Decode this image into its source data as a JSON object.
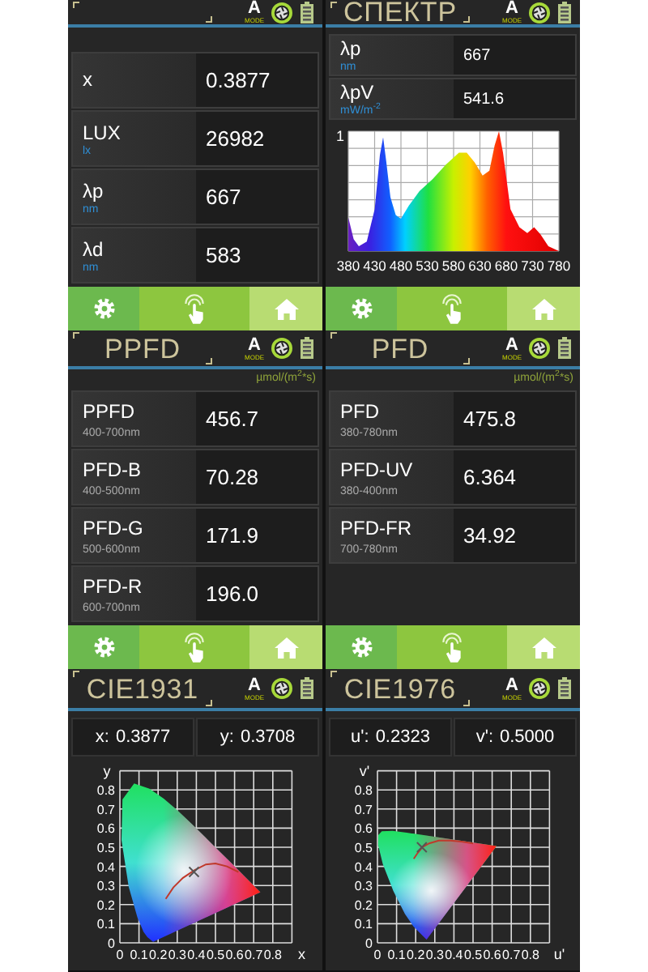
{
  "panels": [
    {
      "kind": "readings",
      "header": {
        "mode_letter": "A",
        "mode_caption": "MODE"
      },
      "rows": [
        {
          "label": "x",
          "value": "0.3877"
        },
        {
          "label": "LUX",
          "unit": "lx",
          "value": "26982"
        },
        {
          "label": "λp",
          "unit": "nm",
          "value": "667"
        },
        {
          "label": "λd",
          "unit": "nm",
          "value": "583"
        }
      ],
      "nav": true
    },
    {
      "kind": "spectrum",
      "header": {
        "title": "СПЕКТР",
        "mode_letter": "A",
        "mode_caption": "MODE"
      },
      "rows": [
        {
          "label": "λp",
          "unit": "nm",
          "value": "667"
        },
        {
          "label": "λpV",
          "unit": "mW/m$^{-2}$",
          "value": "541.6"
        }
      ],
      "spectrum": {
        "y_label": "1",
        "x_labels": [
          "380",
          "430",
          "480",
          "530",
          "580",
          "630",
          "680",
          "730",
          "780"
        ]
      },
      "nav": true
    },
    {
      "kind": "photon",
      "header": {
        "title": "PPFD",
        "mode_letter": "A",
        "mode_caption": "MODE"
      },
      "unit_note": "µmol/(m$^{2}$*s)",
      "rows": [
        {
          "label": "PPFD",
          "range": "400-700nm",
          "value": "456.7"
        },
        {
          "label": "PFD-B",
          "range": "400-500nm",
          "value": "70.28"
        },
        {
          "label": "PFD-G",
          "range": "500-600nm",
          "value": "171.9"
        },
        {
          "label": "PFD-R",
          "range": "600-700nm",
          "value": "196.0"
        }
      ],
      "nav": true
    },
    {
      "kind": "photon",
      "header": {
        "title": "PFD",
        "mode_letter": "A",
        "mode_caption": "MODE"
      },
      "unit_note": "µmol/(m$^{2}$*s)",
      "rows": [
        {
          "label": "PFD",
          "range": "380-780nm",
          "value": "475.8"
        },
        {
          "label": "PFD-UV",
          "range": "380-400nm",
          "value": "6.364"
        },
        {
          "label": "PFD-FR",
          "range": "700-780nm",
          "value": "34.92"
        }
      ],
      "nav": true
    },
    {
      "kind": "chromaticity",
      "header": {
        "title": "CIE1931",
        "mode_letter": "A",
        "mode_caption": "MODE"
      },
      "coordinates": [
        {
          "label": "x:",
          "value": "0.3877"
        },
        {
          "label": "y:",
          "value": "0.3708"
        }
      ],
      "diagram": {
        "kind": "cie1931",
        "y_axis": "y",
        "x_axis": "x",
        "y_ticks": [
          "0.8",
          "0.7",
          "0.6",
          "0.5",
          "0.4",
          "0.3",
          "0.2",
          "0.1",
          "0"
        ],
        "x_ticks": [
          "0",
          "0.1",
          "0.2",
          "0.3",
          "0.4",
          "0.5",
          "0.6",
          "0.7",
          "0.8"
        ]
      }
    },
    {
      "kind": "chromaticity",
      "header": {
        "title": "CIE1976",
        "mode_letter": "A",
        "mode_caption": "MODE"
      },
      "coordinates": [
        {
          "label": "u':",
          "value": "0.2323"
        },
        {
          "label": "v':",
          "value": "0.5000"
        }
      ],
      "diagram": {
        "kind": "cie1976",
        "y_axis": "v'",
        "x_axis": "u'",
        "y_ticks": [
          "0.8",
          "0.7",
          "0.6",
          "0.5",
          "0.4",
          "0.3",
          "0.2",
          "0.1",
          "0"
        ],
        "x_ticks": [
          "0",
          "0.1",
          "0.2",
          "0.3",
          "0.4",
          "0.5",
          "0.6",
          "0.7",
          "0.8"
        ]
      }
    }
  ]
}
